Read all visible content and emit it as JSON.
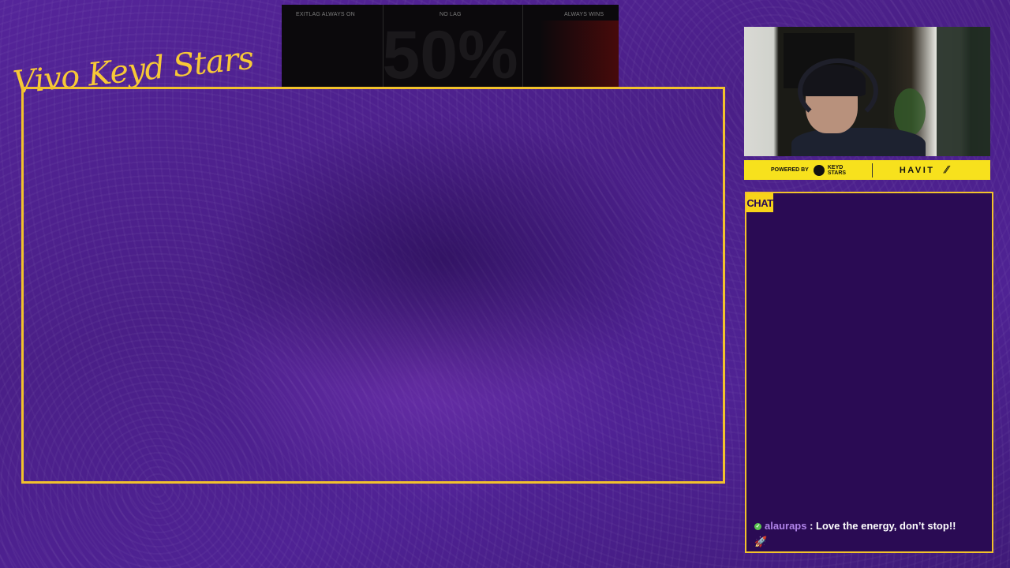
{
  "overlay": {
    "brand_script": "Vivo Keyd Stars",
    "ad_bar": {
      "label_left": "EXITLAG ALWAYS ON",
      "label_center": "NO LAG",
      "label_right": "ALWAYS WINS",
      "big_text": "50%"
    },
    "sponsor_bar": {
      "powered_by": "POWERED BY",
      "keyd_stars": "KEYD STARS",
      "havit": "HAVIT",
      "slash_icon": "slash-logo-icon"
    }
  },
  "chat": {
    "tab_label": "CHAT",
    "messages": [
      {
        "badge_icon": "verified-badge-icon",
        "username": "alauraps",
        "separator": " : ",
        "text": "Love the energy, don’t stop!!",
        "emoji": "🚀"
      }
    ]
  },
  "colors": {
    "accent_yellow": "#f2c22c",
    "background_purple": "#4a1f86",
    "chat_background": "#2a0b54",
    "username_color": "#b084e8"
  }
}
